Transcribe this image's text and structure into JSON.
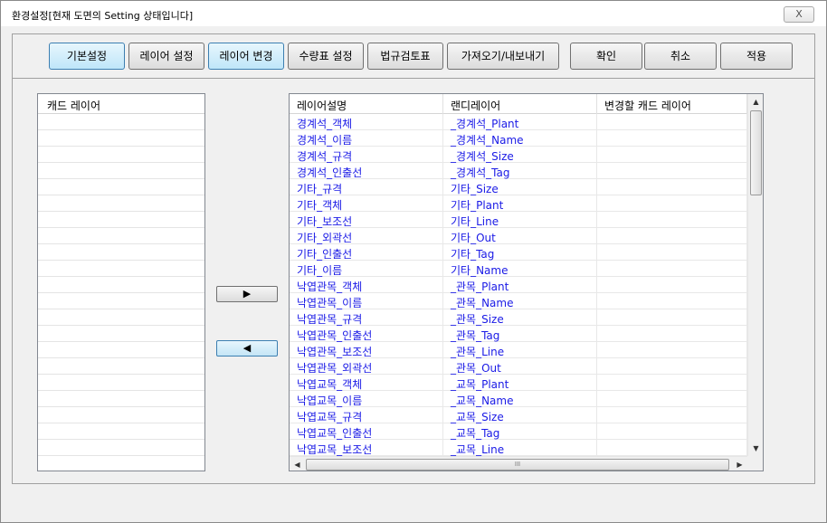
{
  "window": {
    "title": "환경설정[현재 도면의 Setting 상태입니다]",
    "close_label": "X"
  },
  "toolbar": {
    "basic_settings": "기본설정",
    "layer_settings": "레이어 설정",
    "layer_change": "레이어 변경",
    "quantity_settings": "수량표 설정",
    "regulation_review": "법규검토표",
    "import_export": "가져오기/내보내기",
    "ok": "확인",
    "cancel": "취소",
    "apply": "적용"
  },
  "left_list": {
    "header": "캐드 레이어",
    "items": []
  },
  "move_buttons": {
    "right": "▶",
    "left": "◀"
  },
  "grid": {
    "columns": [
      "레이어설명",
      "랜디레이어",
      "변경할 캐드 레이어"
    ],
    "rows": [
      [
        "경계석_객체",
        "_경계석_Plant",
        ""
      ],
      [
        "경계석_이름",
        "_경계석_Name",
        ""
      ],
      [
        "경계석_규격",
        "_경계석_Size",
        ""
      ],
      [
        "경계석_인출선",
        "_경계석_Tag",
        ""
      ],
      [
        "기타_규격",
        "기타_Size",
        ""
      ],
      [
        "기타_객체",
        "기타_Plant",
        ""
      ],
      [
        "기타_보조선",
        "기타_Line",
        ""
      ],
      [
        "기타_외곽선",
        "기타_Out",
        ""
      ],
      [
        "기타_인출선",
        "기타_Tag",
        ""
      ],
      [
        "기타_이름",
        "기타_Name",
        ""
      ],
      [
        "낙엽관목_객체",
        "_관목_Plant",
        ""
      ],
      [
        "낙엽관목_이름",
        "_관목_Name",
        ""
      ],
      [
        "낙엽관목_규격",
        "_관목_Size",
        ""
      ],
      [
        "낙엽관목_인출선",
        "_관목_Tag",
        ""
      ],
      [
        "낙엽관목_보조선",
        "_관목_Line",
        ""
      ],
      [
        "낙엽관목_외곽선",
        "_관목_Out",
        ""
      ],
      [
        "낙엽교목_객체",
        "_교목_Plant",
        ""
      ],
      [
        "낙엽교목_이름",
        "_교목_Name",
        ""
      ],
      [
        "낙엽교목_규격",
        "_교목_Size",
        ""
      ],
      [
        "낙엽교목_인출선",
        "_교목_Tag",
        ""
      ],
      [
        "낙엽교목_보조선",
        "_교목_Line",
        ""
      ]
    ]
  },
  "scrollbars": {
    "up": "▲",
    "down": "▼",
    "left": "◀",
    "right": "▶",
    "grip": "III"
  }
}
